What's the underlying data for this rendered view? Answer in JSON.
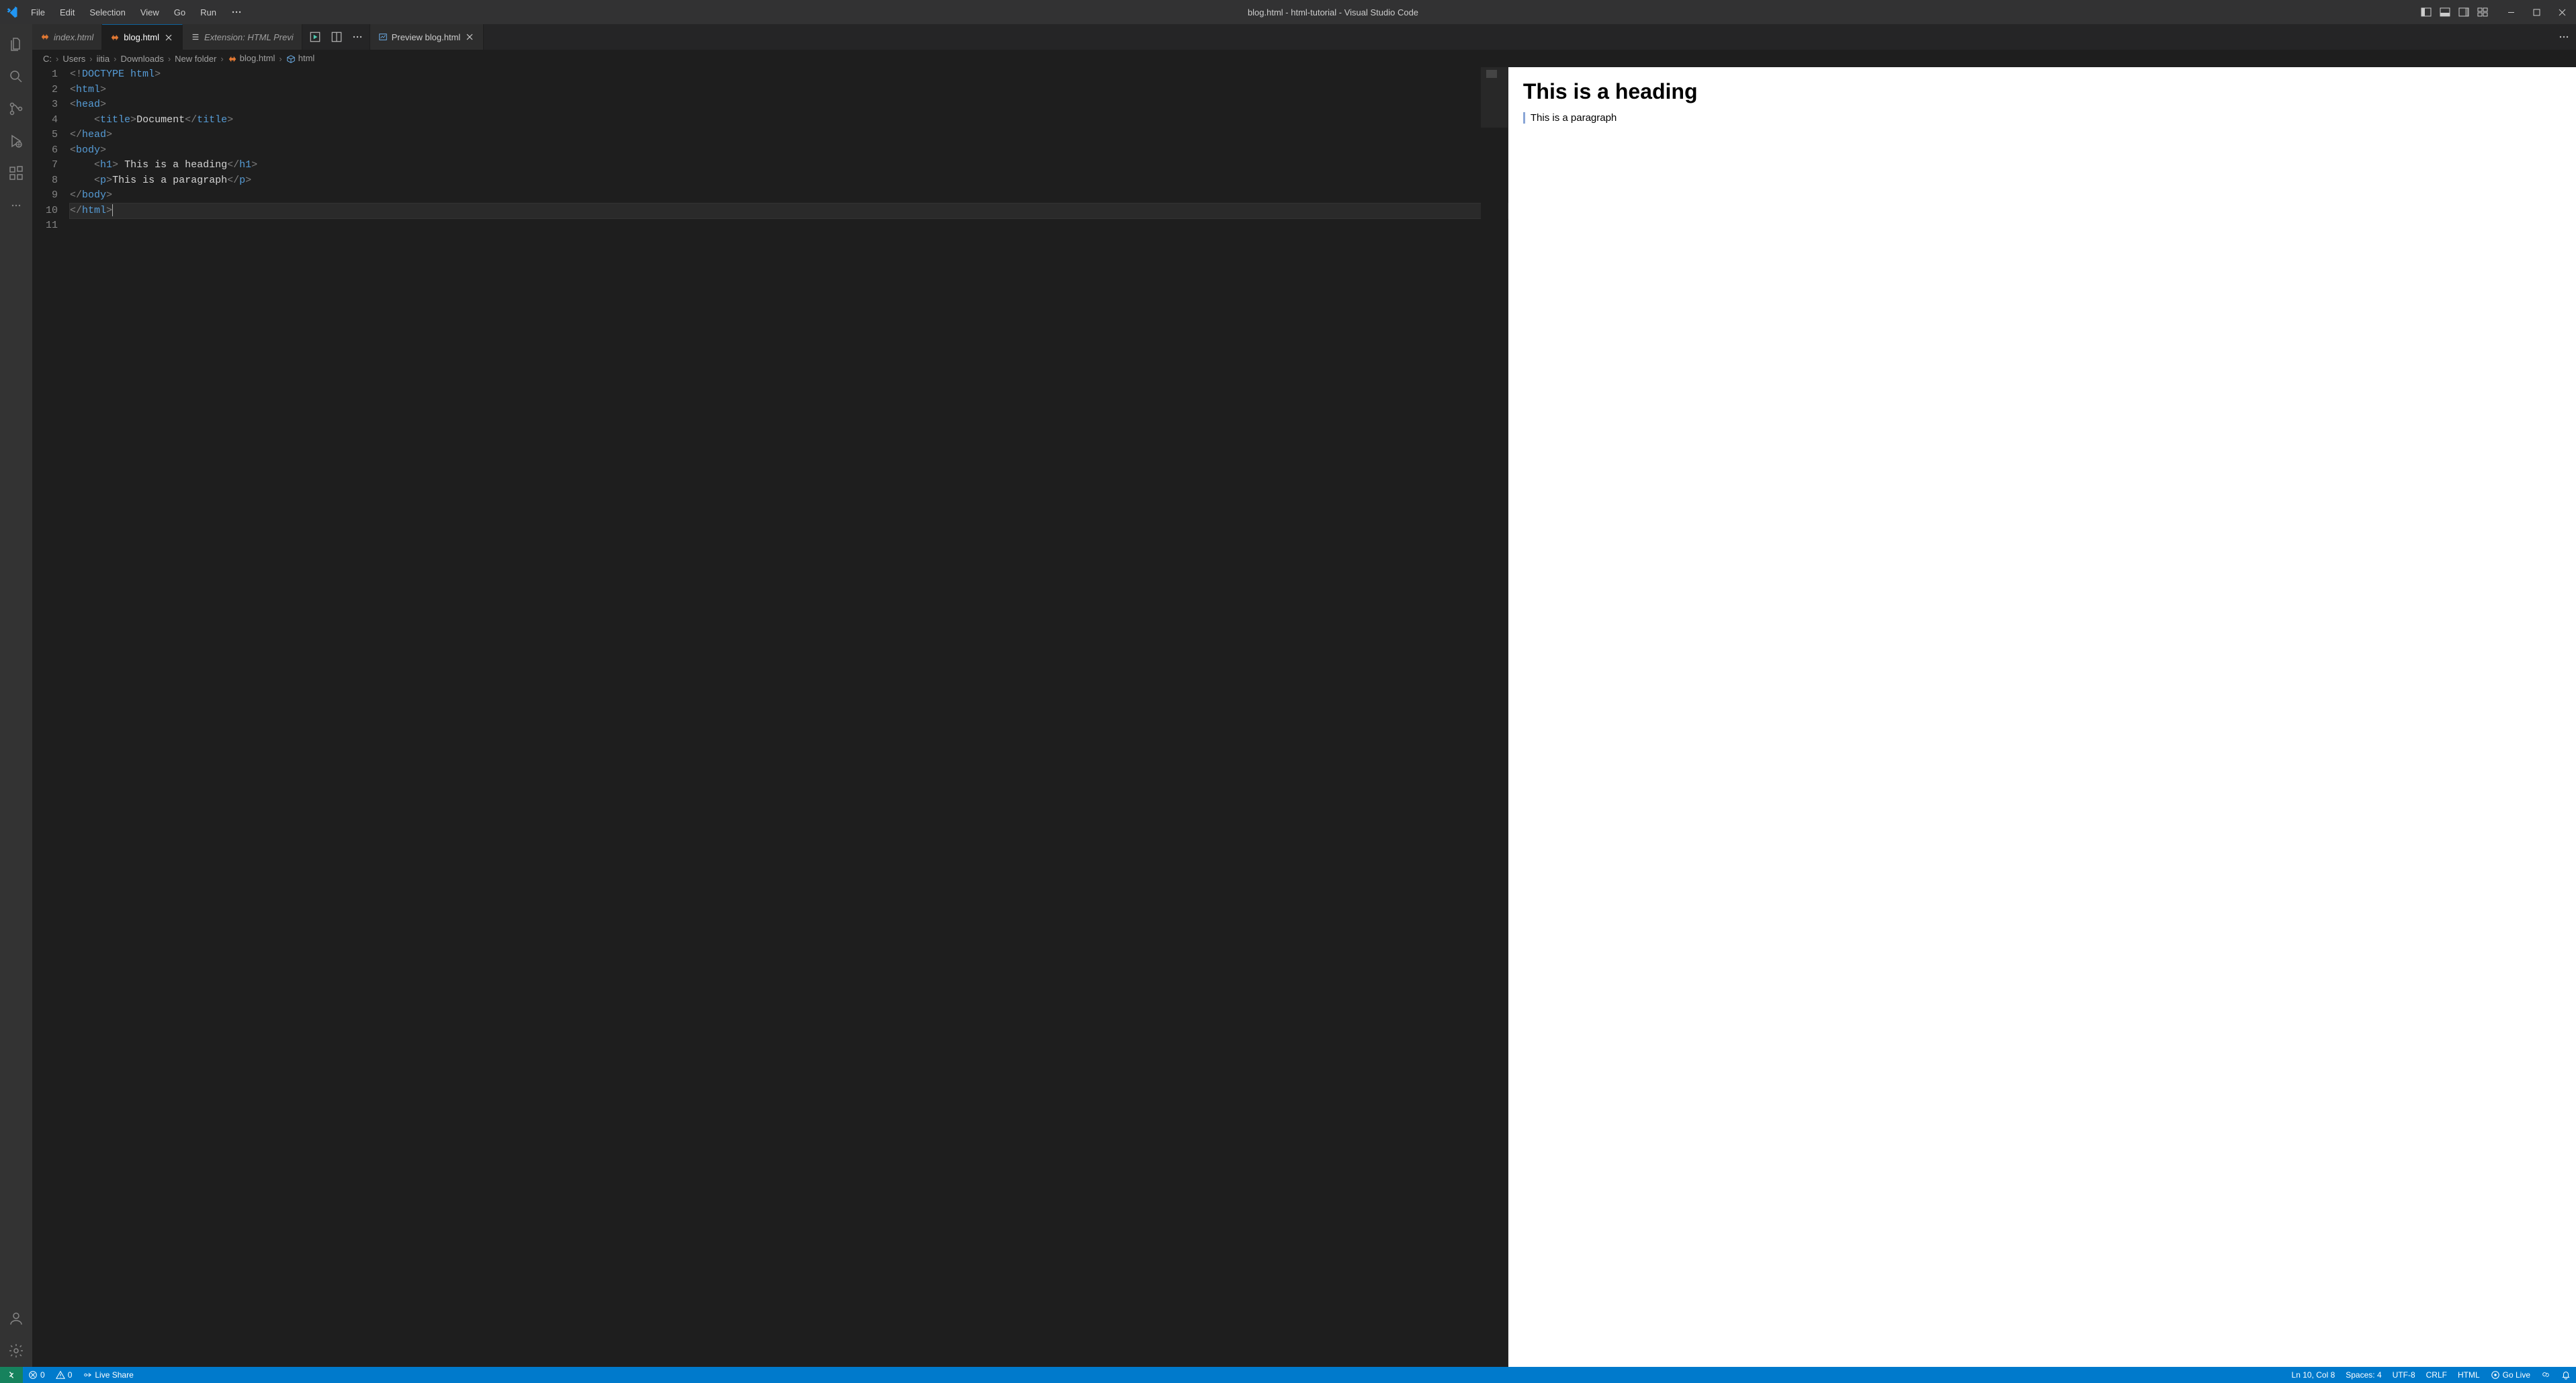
{
  "window": {
    "title": "blog.html - html-tutorial - Visual Studio Code"
  },
  "menu": [
    "File",
    "Edit",
    "Selection",
    "View",
    "Go",
    "Run"
  ],
  "tabs": {
    "left_group": [
      {
        "label": "index.html",
        "active": false,
        "italic": true,
        "closeable": false
      },
      {
        "label": "blog.html",
        "active": true,
        "italic": false,
        "closeable": true
      },
      {
        "label": "Extension: HTML Previ",
        "active": false,
        "italic": true,
        "closeable": false
      }
    ],
    "right_group": [
      {
        "label": "Preview blog.html",
        "active": false,
        "italic": false,
        "closeable": true
      }
    ]
  },
  "breadcrumbs": [
    "C:",
    "Users",
    "iitia",
    "Downloads",
    "New folder",
    "blog.html",
    "html"
  ],
  "editor": {
    "lines": [
      {
        "n": 1,
        "segments": [
          [
            "<!",
            "punct"
          ],
          [
            "DOCTYPE",
            "doctype"
          ],
          [
            " ",
            "text"
          ],
          [
            "html",
            "tag"
          ],
          [
            ">",
            "punct"
          ]
        ]
      },
      {
        "n": 2,
        "segments": [
          [
            "<",
            "punct"
          ],
          [
            "html",
            "tag"
          ],
          [
            ">",
            "punct"
          ]
        ]
      },
      {
        "n": 3,
        "segments": [
          [
            "<",
            "punct"
          ],
          [
            "head",
            "tag"
          ],
          [
            ">",
            "punct"
          ]
        ]
      },
      {
        "n": 4,
        "segments": [
          [
            "    ",
            "text"
          ],
          [
            "<",
            "punct"
          ],
          [
            "title",
            "tag"
          ],
          [
            ">",
            "punct"
          ],
          [
            "Document",
            "text"
          ],
          [
            "</",
            "punct"
          ],
          [
            "title",
            "tag"
          ],
          [
            ">",
            "punct"
          ]
        ]
      },
      {
        "n": 5,
        "segments": [
          [
            "</",
            "punct"
          ],
          [
            "head",
            "tag"
          ],
          [
            ">",
            "punct"
          ]
        ]
      },
      {
        "n": 6,
        "segments": [
          [
            "<",
            "punct"
          ],
          [
            "body",
            "tag"
          ],
          [
            ">",
            "punct"
          ]
        ]
      },
      {
        "n": 7,
        "segments": [
          [
            "    ",
            "text"
          ],
          [
            "<",
            "punct"
          ],
          [
            "h1",
            "tag"
          ],
          [
            ">",
            "punct"
          ],
          [
            " This is a heading",
            "text"
          ],
          [
            "</",
            "punct"
          ],
          [
            "h1",
            "tag"
          ],
          [
            ">",
            "punct"
          ]
        ]
      },
      {
        "n": 8,
        "segments": [
          [
            "    ",
            "text"
          ],
          [
            "<",
            "punct"
          ],
          [
            "p",
            "tag"
          ],
          [
            ">",
            "punct"
          ],
          [
            "This is a paragraph",
            "text"
          ],
          [
            "</",
            "punct"
          ],
          [
            "p",
            "tag"
          ],
          [
            ">",
            "punct"
          ]
        ]
      },
      {
        "n": 9,
        "segments": [
          [
            "</",
            "punct"
          ],
          [
            "body",
            "tag"
          ],
          [
            ">",
            "punct"
          ]
        ]
      },
      {
        "n": 10,
        "segments": [
          [
            "</",
            "punct"
          ],
          [
            "html",
            "tag"
          ],
          [
            ">",
            "punct"
          ]
        ],
        "current": true
      },
      {
        "n": 11,
        "segments": []
      }
    ]
  },
  "preview": {
    "heading": "This is a heading",
    "paragraph": "This is a paragraph"
  },
  "status": {
    "errors": "0",
    "warnings": "0",
    "live_share": "Live Share",
    "cursor": "Ln 10, Col 8",
    "spaces": "Spaces: 4",
    "encoding": "UTF-8",
    "eol": "CRLF",
    "language": "HTML",
    "go_live": "Go Live"
  }
}
